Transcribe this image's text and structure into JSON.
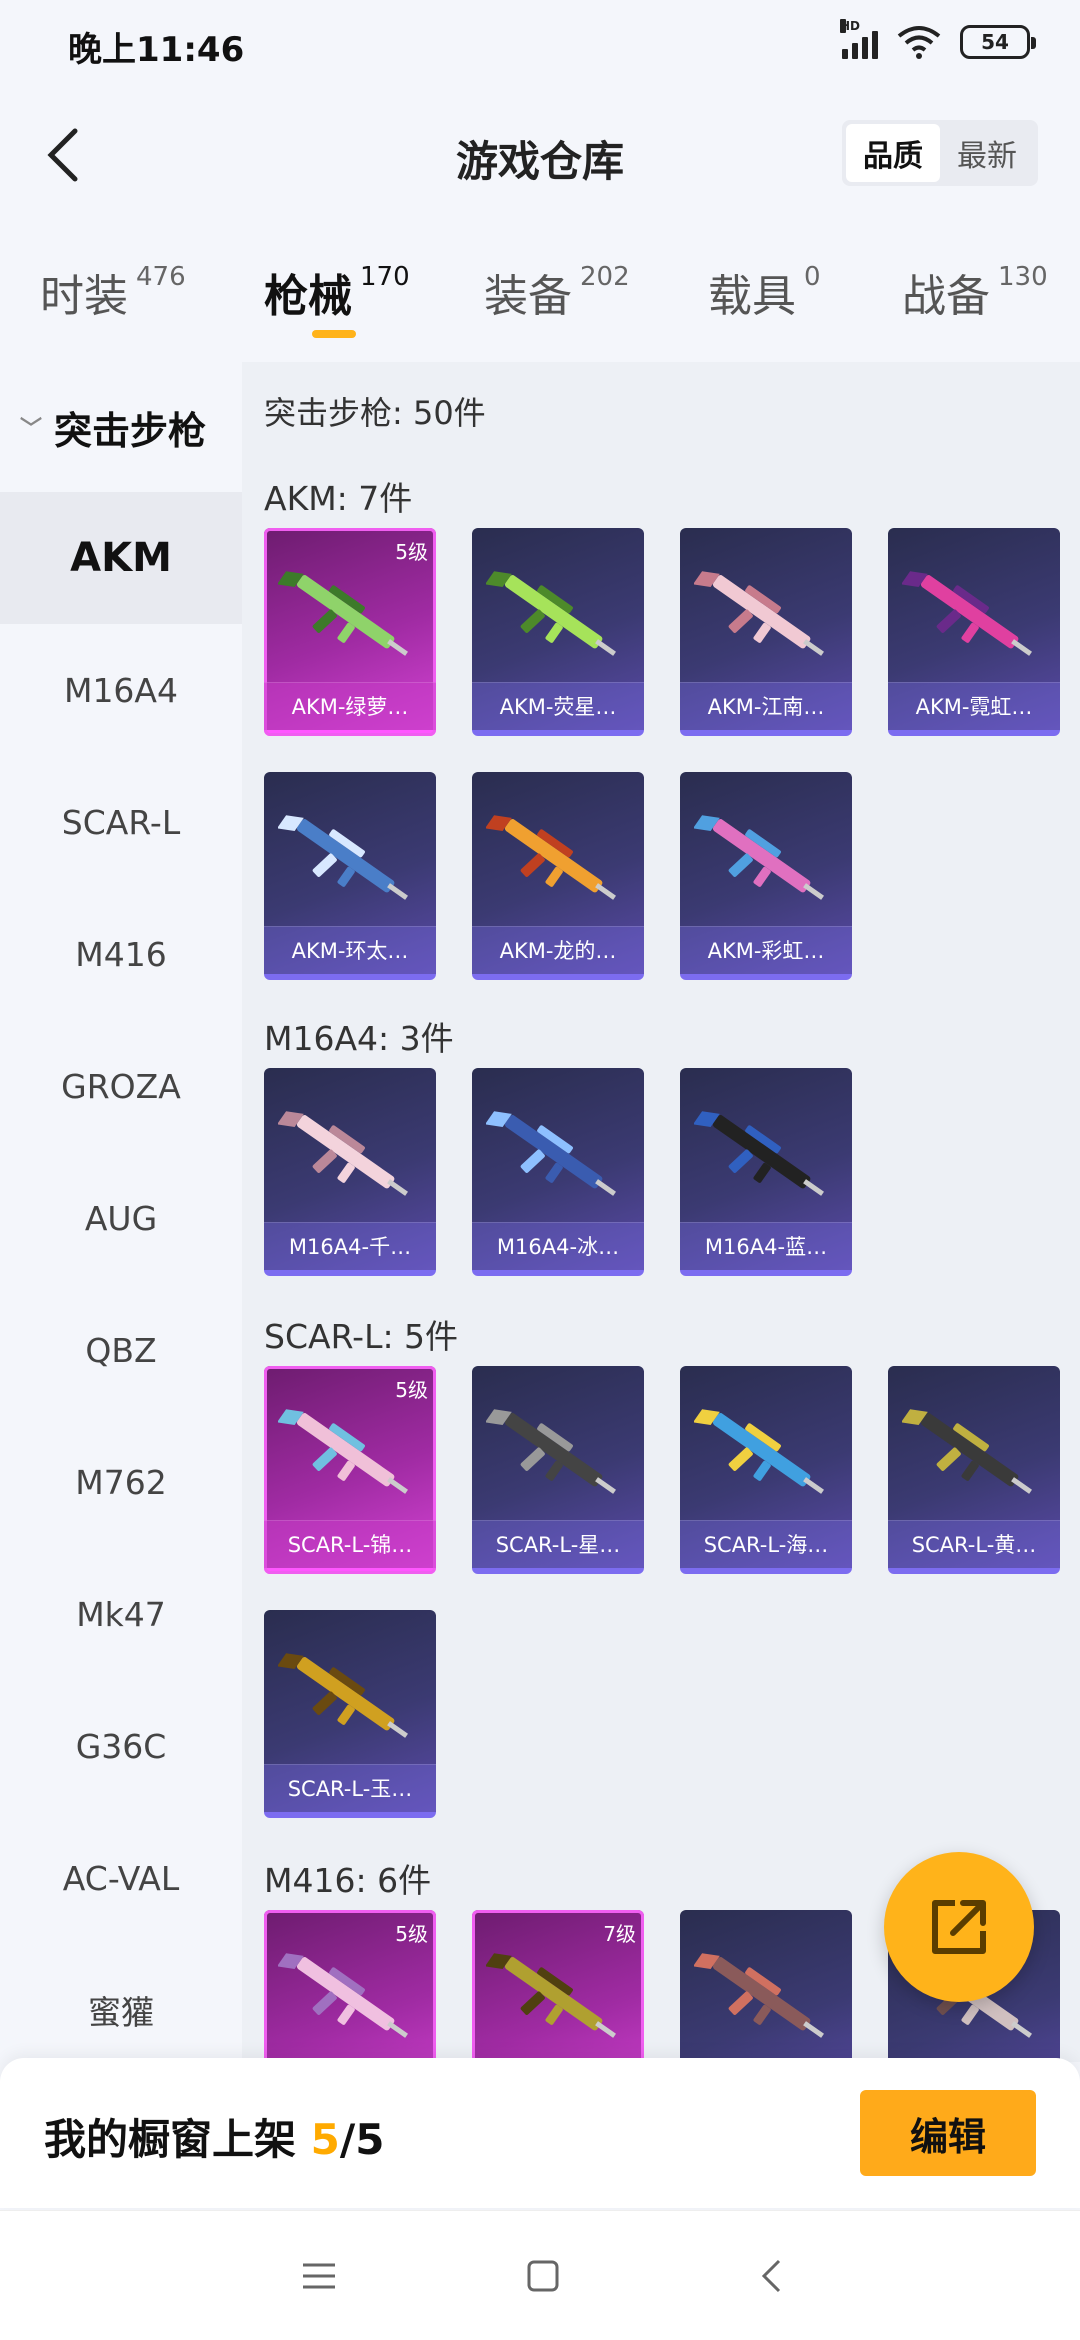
{
  "status_bar": {
    "time": "晚上11:46",
    "network": "HD",
    "battery": "54"
  },
  "header": {
    "title": "游戏仓库",
    "sort_options": [
      "品质",
      "最新"
    ],
    "active_sort": "品质"
  },
  "tabs": [
    {
      "label": "时装",
      "count": "476"
    },
    {
      "label": "枪械",
      "count": "170"
    },
    {
      "label": "装备",
      "count": "202"
    },
    {
      "label": "载具",
      "count": "0"
    },
    {
      "label": "战备",
      "count": "130"
    }
  ],
  "active_tab": "枪械",
  "sidebar": {
    "group": "突击步枪",
    "items": [
      "AKM",
      "M16A4",
      "SCAR-L",
      "M416",
      "GROZA",
      "AUG",
      "QBZ",
      "M762",
      "Mk47",
      "G36C",
      "AC-VAL",
      "蜜獾"
    ],
    "active": "AKM"
  },
  "main": {
    "summary": "突击步枪: 50件",
    "sections": [
      {
        "title": "AKM: 7件",
        "items": [
          {
            "name": "AKM-绿萝…",
            "level": "5级",
            "rarity": "legendary"
          },
          {
            "name": "AKM-荧星…",
            "level": "",
            "rarity": "epic"
          },
          {
            "name": "AKM-江南…",
            "level": "",
            "rarity": "epic"
          },
          {
            "name": "AKM-霓虹…",
            "level": "",
            "rarity": "epic"
          },
          {
            "name": "AKM-环太…",
            "level": "",
            "rarity": "epic"
          },
          {
            "name": "AKM-龙的…",
            "level": "",
            "rarity": "epic"
          },
          {
            "name": "AKM-彩虹…",
            "level": "",
            "rarity": "epic"
          }
        ]
      },
      {
        "title": "M16A4: 3件",
        "items": [
          {
            "name": "M16A4-千…",
            "level": "",
            "rarity": "epic"
          },
          {
            "name": "M16A4-冰…",
            "level": "",
            "rarity": "epic"
          },
          {
            "name": "M16A4-蓝…",
            "level": "",
            "rarity": "epic"
          }
        ]
      },
      {
        "title": "SCAR-L: 5件",
        "items": [
          {
            "name": "SCAR-L-锦…",
            "level": "5级",
            "rarity": "legendary"
          },
          {
            "name": "SCAR-L-星…",
            "level": "",
            "rarity": "epic"
          },
          {
            "name": "SCAR-L-海…",
            "level": "",
            "rarity": "epic"
          },
          {
            "name": "SCAR-L-黄…",
            "level": "",
            "rarity": "epic"
          },
          {
            "name": "SCAR-L-玉…",
            "level": "",
            "rarity": "epic"
          }
        ]
      },
      {
        "title": "M416: 6件",
        "items": [
          {
            "name": "",
            "level": "5级",
            "rarity": "legendary"
          },
          {
            "name": "",
            "level": "7级",
            "rarity": "legendary"
          },
          {
            "name": "",
            "level": "",
            "rarity": "epic"
          },
          {
            "name": "",
            "level": "",
            "rarity": "epic"
          }
        ]
      }
    ]
  },
  "shelf": {
    "label": "我的橱窗上架",
    "current": "5",
    "total": "/5",
    "edit_label": "编辑"
  },
  "colors": {
    "accent": "#ffaa1a",
    "legendary": "#d443d4",
    "epic": "#5a4aa8"
  },
  "icons": {
    "back": "chevron-left-icon",
    "share": "share-out-icon",
    "nav": [
      "menu-icon",
      "home-square-icon",
      "back-triangle-icon"
    ]
  }
}
